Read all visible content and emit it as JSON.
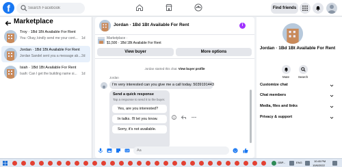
{
  "topbar": {
    "search_placeholder": "Search Facebook",
    "find_friends": "Find friends"
  },
  "sidebar": {
    "title": "Marketplace",
    "conversations": [
      {
        "title": "Troy · 1Bd 1Bt Available For Rent",
        "snippet": "You: Okay, kindly send me your cont...",
        "age": "1d",
        "active": false
      },
      {
        "title": "Jordan · 1Bd 1Bt Available For Rent",
        "snippet": "Jordan Sandel sent you a message ab...",
        "age": "2d",
        "active": true
      },
      {
        "title": "Isiah · 1Bd 1Bt Available For Rent",
        "snippet": "Isaih: Can I get the building name si...",
        "age": "1d",
        "active": false
      }
    ]
  },
  "chat": {
    "title": "Jordan · 1Bd 1Bt Available For Rent",
    "listing_source": "Marketplace ·",
    "listing_price": "$1,500 · 1Bd 1Bt Available For Rent",
    "view_buyer_label": "View buyer",
    "more_options_label": "More options",
    "system_note_prefix": "Jordan started this chat.",
    "system_note_link": "View buyer profile",
    "sender_name": "Jordan",
    "message": "I'm very interested can you give me a call today. 5039191443",
    "quick_response_title": "Send a quick response",
    "quick_response_subtitle": "Tap a response to send it to the buyer.",
    "quick_responses": [
      "Yes, are you interested?",
      "In talks. I'll let you know.",
      "Sorry, it's not available."
    ],
    "composer_placeholder": "Aa"
  },
  "details": {
    "title": "Jordan · 1Bd 1Bt Available For Rent",
    "mute_label": "Mute",
    "search_label": "Search",
    "menu": [
      "Customize chat",
      "Chat members",
      "Media, files and links",
      "Privacy & support"
    ]
  },
  "taskbar": {
    "stock": "GBP...",
    "lang": "ENG",
    "time": "10:45 PM",
    "date": "10/6/2022"
  },
  "colors": {
    "brand_blue": "#1877f2",
    "messenger_purple": "#a033ff",
    "active_row": "#e7f0fb"
  }
}
